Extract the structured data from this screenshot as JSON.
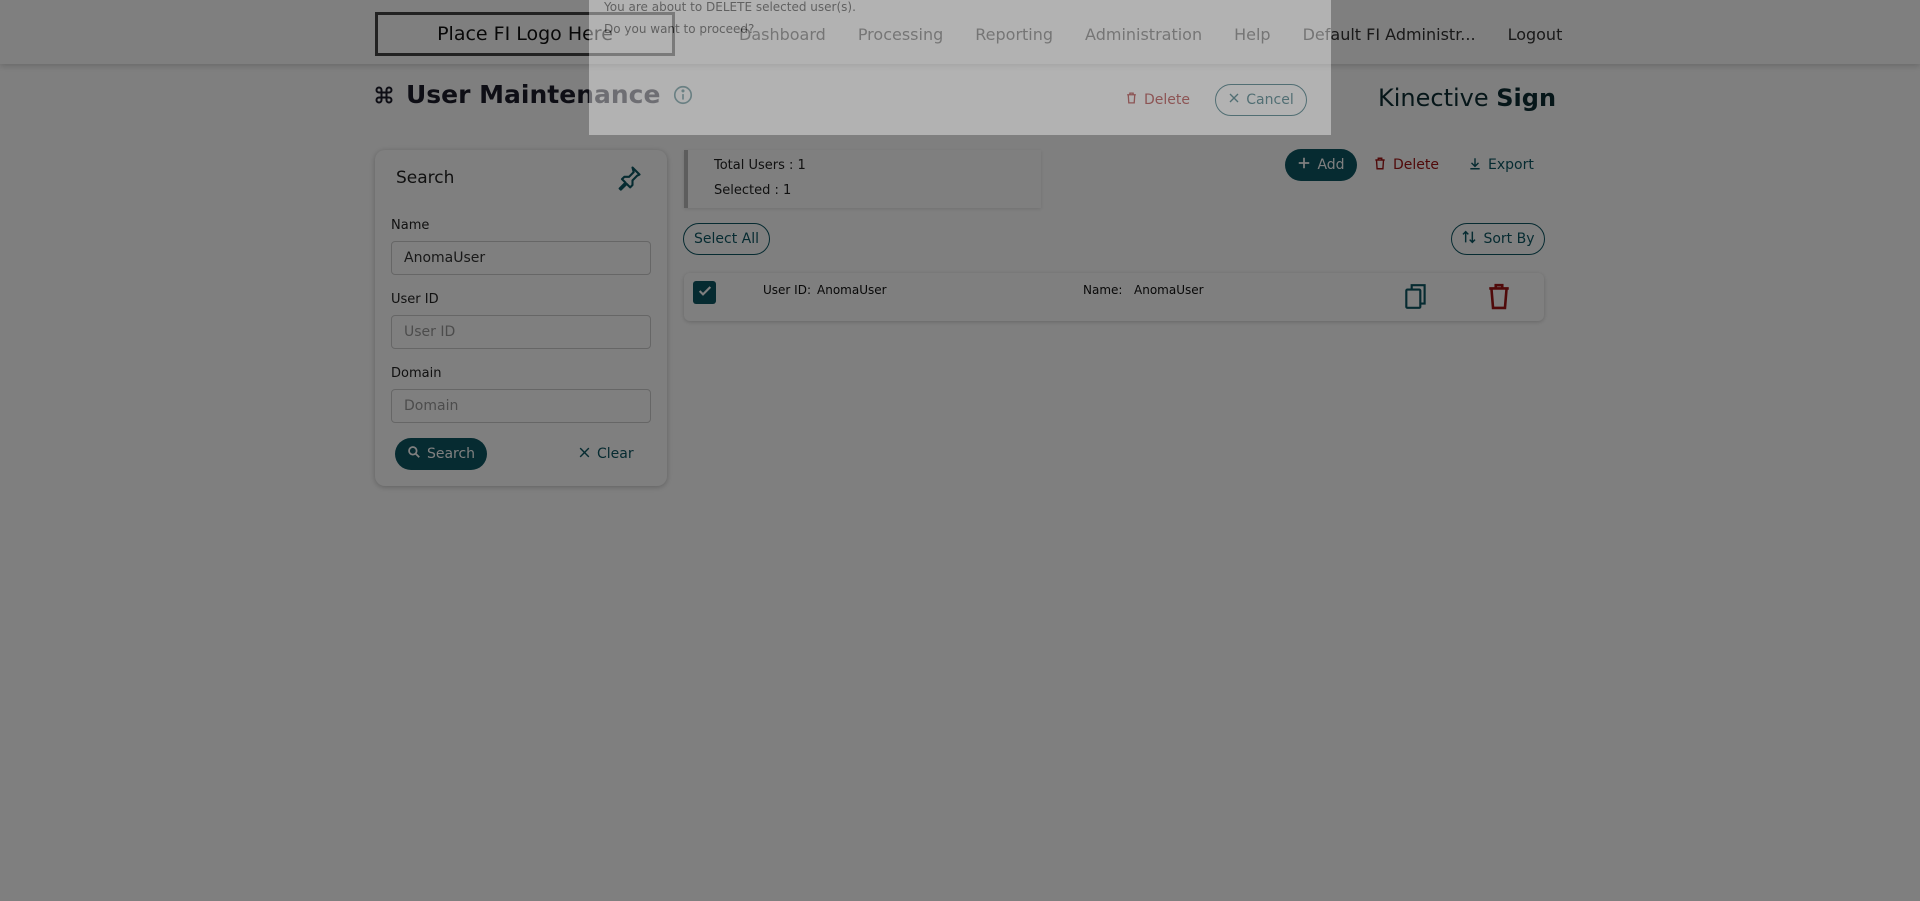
{
  "header": {
    "logo_text": "Place FI Logo Here",
    "nav": [
      "Dashboard",
      "Processing",
      "Reporting",
      "Administration",
      "Help",
      "Default FI Administr...",
      "Logout"
    ]
  },
  "page": {
    "title": "User Maintenance",
    "brand_light": "Kinective ",
    "brand_bold": "Sign"
  },
  "search": {
    "title": "Search",
    "name_label": "Name",
    "name_value": "AnomaUser",
    "userid_label": "User ID",
    "userid_placeholder": "User ID",
    "domain_label": "Domain",
    "domain_placeholder": "Domain",
    "search_button": "Search",
    "clear_button": "Clear"
  },
  "summary": {
    "total_users": "Total Users : 1",
    "selected": "Selected : 1"
  },
  "actions": {
    "add": "Add",
    "delete": "Delete",
    "export": "Export",
    "select_all": "Select All",
    "sort_by": "Sort By"
  },
  "users": [
    {
      "userid_label": "User ID:",
      "userid": "AnomaUser",
      "name_label": "Name:",
      "name": "AnomaUser",
      "checked": true
    }
  ],
  "dialog": {
    "line1": "You are about to DELETE selected user(s).",
    "line2": "Do you want to proceed?",
    "delete": "Delete",
    "cancel": "Cancel"
  },
  "colors": {
    "primary": "#0d5662",
    "danger": "#a01515"
  }
}
